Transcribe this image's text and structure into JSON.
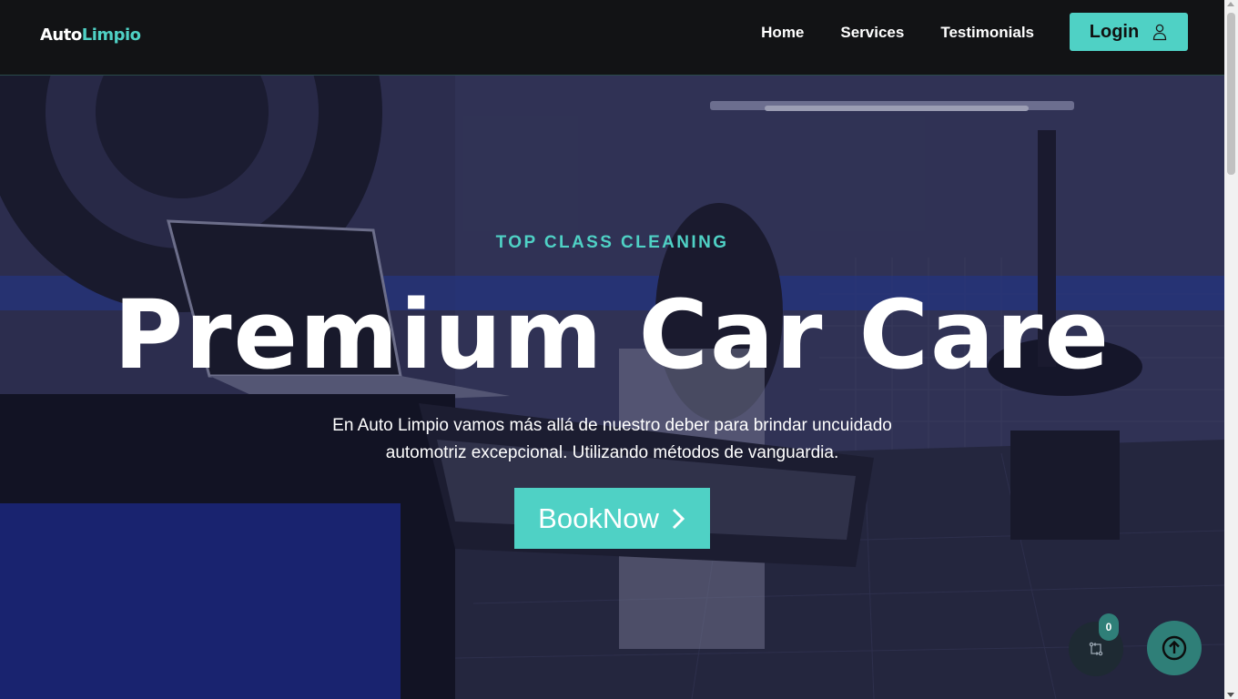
{
  "brand": {
    "logo_part1": "Auto",
    "logo_part2": "Limpio"
  },
  "nav": {
    "links": [
      {
        "label": "Home"
      },
      {
        "label": "Services"
      },
      {
        "label": "Testimonials"
      }
    ],
    "login_label": "Login",
    "login_icon": "user-icon"
  },
  "hero": {
    "kicker": "TOP CLASS CLEANING",
    "title": "Premium Car Care",
    "description": "En Auto Limpio vamos más allá de nuestro deber para brindar uncuidado automotriz excepcional. Utilizando métodos de vanguardia.",
    "cta_label": "BookNow",
    "cta_icon": "chevron-right-icon"
  },
  "floating": {
    "compare_count": "0",
    "compare_icon": "compare-arrows-icon",
    "back_to_top_icon": "arrow-up-circle-icon"
  },
  "colors": {
    "accent": "#4fd1c5",
    "navbar": "#121315",
    "fab_dark": "#1e2a33",
    "fab_teal": "#2f7f78"
  }
}
